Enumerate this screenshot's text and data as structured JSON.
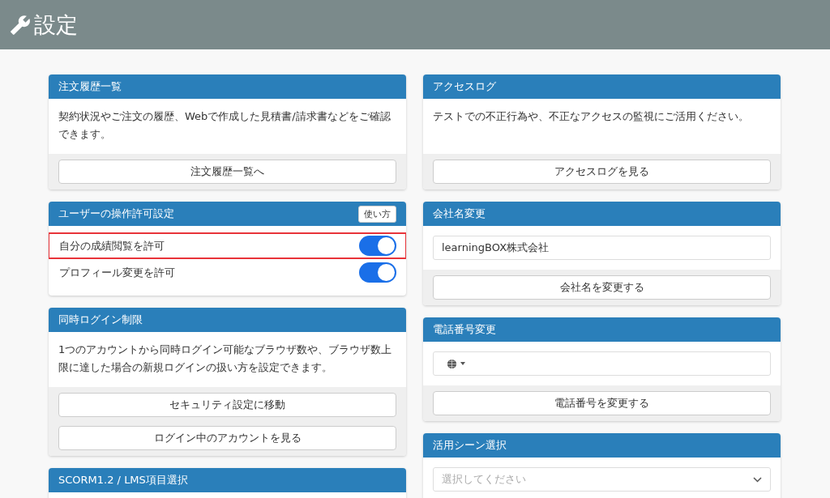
{
  "page": {
    "title": "設定"
  },
  "columns": [
    [
      {
        "title": "注文履歴一覧",
        "description": "契約状況やご注文の履歴、Webで作成した見積書/請求書などをご確認できます。",
        "buttons": [
          "注文履歴一覧へ"
        ]
      },
      {
        "title": "ユーザーの操作許可設定",
        "help_button": "使い方",
        "toggles": [
          {
            "label": "自分の成績閲覧を許可",
            "on": true,
            "highlighted": true
          },
          {
            "label": "プロフィール変更を許可",
            "on": true,
            "highlighted": false
          }
        ]
      },
      {
        "title": "同時ログイン制限",
        "description": "1つのアカウントから同時ログイン可能なブラウザ数や、ブラウザ数上限に達した場合の新規ログインの扱い方を設定できます。",
        "buttons": [
          "セキュリティ設定に移動",
          "ログイン中のアカウントを見る"
        ]
      },
      {
        "title": "SCORM1.2 / LMS項目選択"
      }
    ],
    [
      {
        "title": "アクセスログ",
        "description": "テストでの不正行為や、不正なアクセスの監視にご活用ください。",
        "buttons": [
          "アクセスログを見る"
        ]
      },
      {
        "title": "会社名変更",
        "field": {
          "kind": "text",
          "value": "learningBOX株式会社"
        },
        "buttons": [
          "会社名を変更する"
        ]
      },
      {
        "title": "電話番号変更",
        "field": {
          "kind": "phone"
        },
        "buttons": [
          "電話番号を変更する"
        ]
      },
      {
        "title": "活用シーン選択",
        "field": {
          "kind": "select",
          "placeholder": "選択してください"
        }
      }
    ]
  ]
}
